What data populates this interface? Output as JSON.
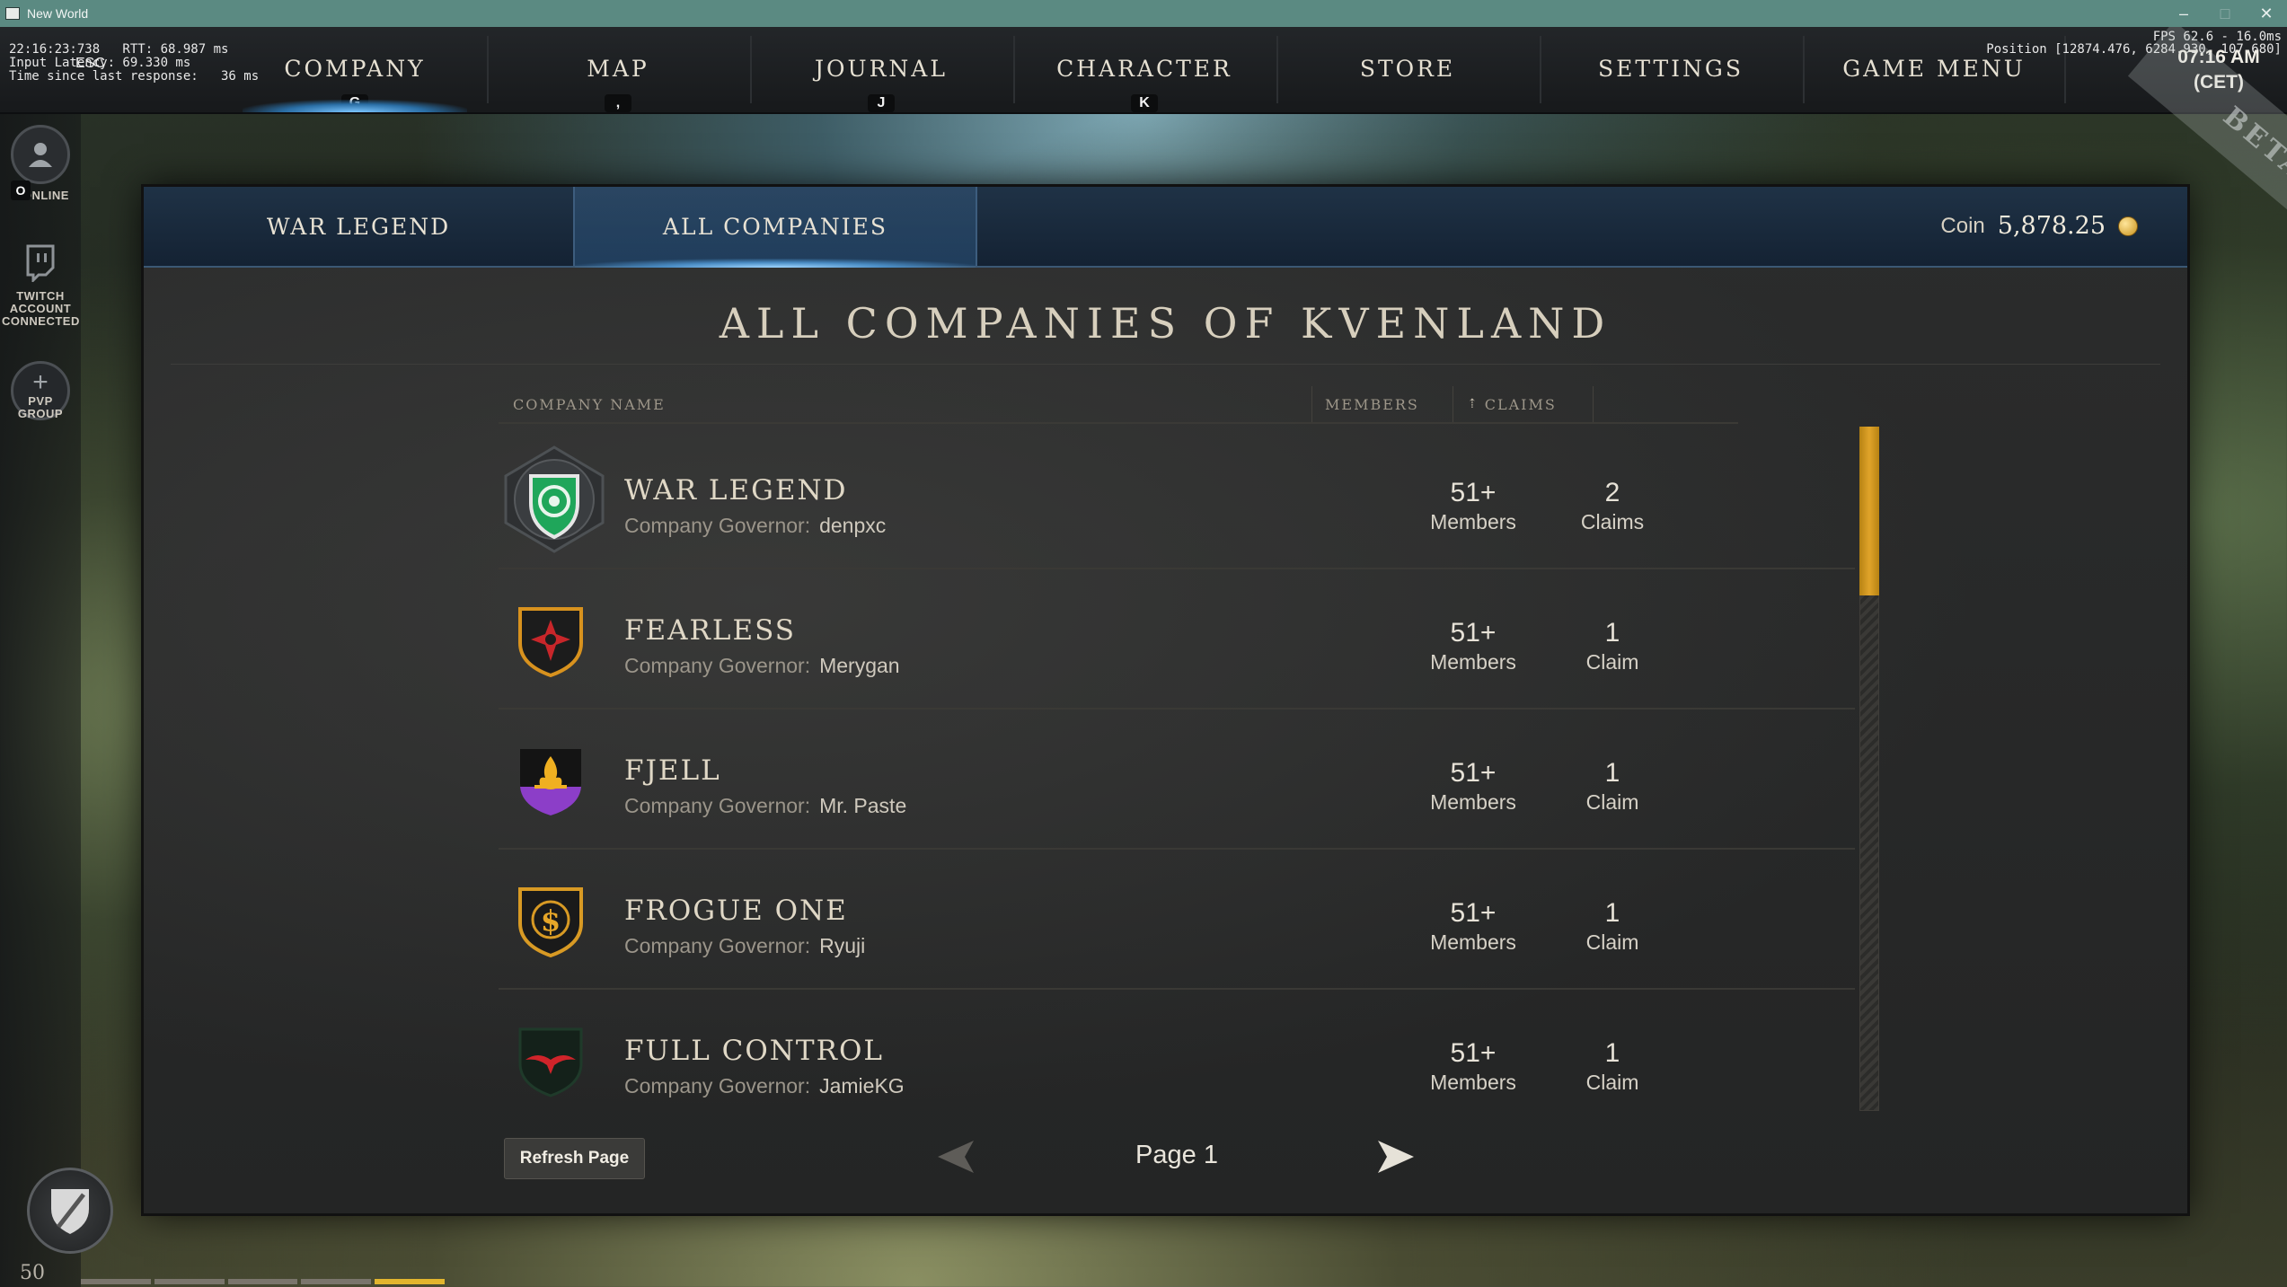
{
  "window": {
    "title": "New World",
    "controls": [
      "–",
      "□",
      "✕"
    ]
  },
  "debug": {
    "left_lines": [
      "22:16:23:738   RTT: 68.987 ms",
      "Input Latency: 69.330 ms",
      "Time since last response:   36 ms"
    ],
    "esc_label": "ESC",
    "fps": "FPS 62.6 - 16.0ms",
    "position": "Position [12874.476, 6284.930, 107.680]"
  },
  "clock": {
    "time": "07:16 AM",
    "zone": "(CET)"
  },
  "beta_label": "BETA",
  "nav": [
    {
      "label": "COMPANY",
      "key": "G"
    },
    {
      "label": "MAP",
      "key": ","
    },
    {
      "label": "JOURNAL",
      "key": "J"
    },
    {
      "label": "CHARACTER",
      "key": "K"
    },
    {
      "label": "STORE",
      "key": ""
    },
    {
      "label": "SETTINGS",
      "key": ""
    },
    {
      "label": "GAME MENU",
      "key": ""
    }
  ],
  "rail": {
    "social": {
      "key": "O",
      "label": "1 ONLINE"
    },
    "twitch": {
      "label": "TWITCH ACCOUNT CONNECTED"
    },
    "pvp": {
      "label": "PVP GROUP"
    }
  },
  "tabs": [
    {
      "label": "WAR LEGEND"
    },
    {
      "label": "ALL COMPANIES"
    }
  ],
  "coin": {
    "label": "Coin",
    "value": "5,878.25"
  },
  "page": {
    "heading": "ALL COMPANIES OF KVENLAND",
    "columns": {
      "company_name": "COMPANY NAME",
      "members": "MEMBERS",
      "claims": "CLAIMS"
    },
    "governor_prefix": "Company Governor:",
    "companies": [
      {
        "name": "WAR LEGEND",
        "governor": "denpxc",
        "members": "51+",
        "members_unit": "Members",
        "claims": "2",
        "claims_unit": "Claims",
        "crest": "green-rose-crest"
      },
      {
        "name": "FEARLESS",
        "governor": "Merygan",
        "members": "51+",
        "members_unit": "Members",
        "claims": "1",
        "claims_unit": "Claim",
        "crest": "red-cross-crest"
      },
      {
        "name": "FJELL",
        "governor": "Mr. Paste",
        "members": "51+",
        "members_unit": "Members",
        "claims": "1",
        "claims_unit": "Claim",
        "crest": "purple-flame-crest"
      },
      {
        "name": "FROGUE ONE",
        "governor": "Ryuji",
        "members": "51+",
        "members_unit": "Members",
        "claims": "1",
        "claims_unit": "Claim",
        "crest": "gold-dollar-crest"
      },
      {
        "name": "FULL CONTROL",
        "governor": "JamieKG",
        "members": "51+",
        "members_unit": "Members",
        "claims": "1",
        "claims_unit": "Claim",
        "crest": "red-bird-crest"
      }
    ],
    "refresh_label": "Refresh Page",
    "pager_label": "Page 1"
  },
  "player": {
    "level": "50"
  },
  "colors": {
    "accent_blue": "#2a6ea5",
    "scroll_gold": "#e0a42a",
    "tabbar": "#1f3246"
  }
}
